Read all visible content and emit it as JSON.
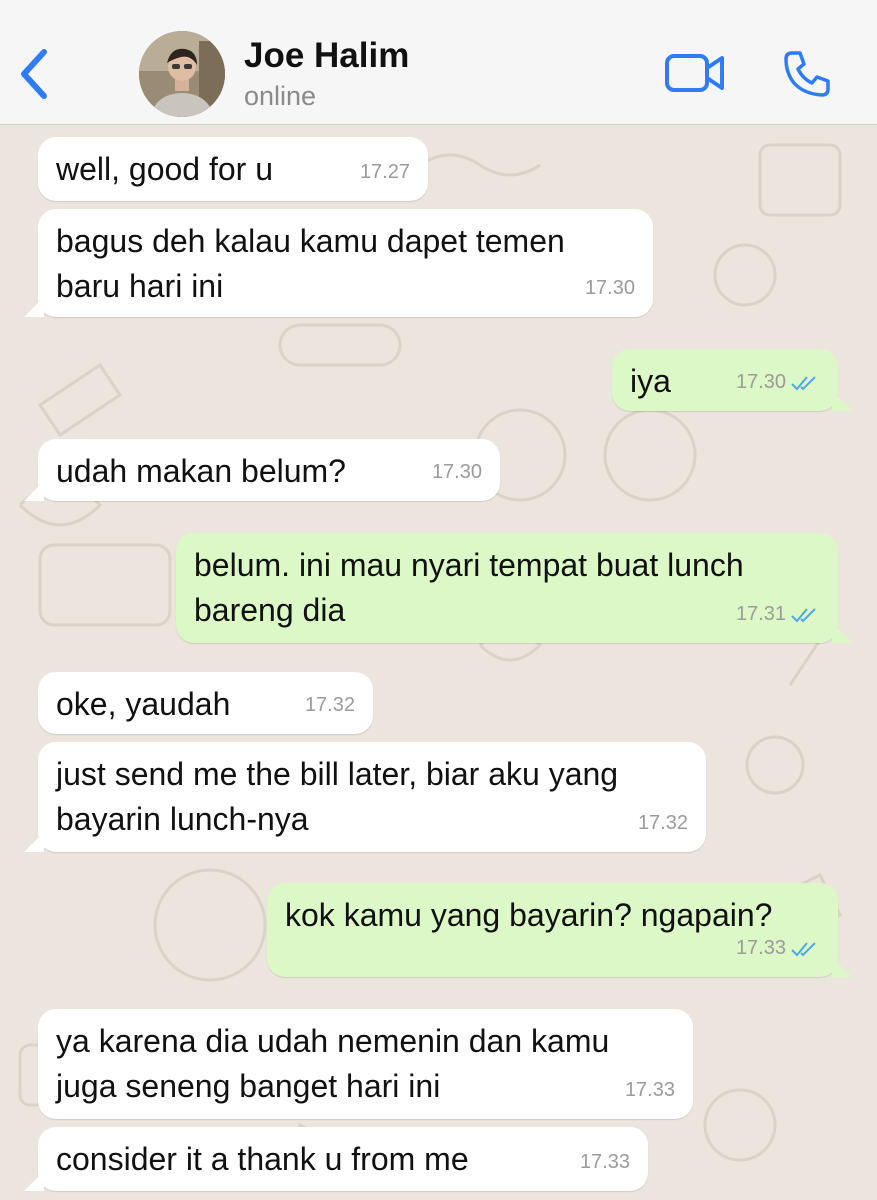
{
  "header": {
    "contact_name": "Joe Halim",
    "status": "online"
  },
  "colors": {
    "accent": "#2f7cf6",
    "incoming_bubble": "#ffffff",
    "outgoing_bubble": "#dcf8c6",
    "read_tick": "#4fa8e8"
  },
  "icons": {
    "back": "chevron-left-icon",
    "video": "video-camera-icon",
    "call": "phone-icon",
    "read": "double-check-icon"
  },
  "messages": [
    {
      "direction": "in",
      "text": "well, good for u",
      "time": "17.27"
    },
    {
      "direction": "in",
      "text": "bagus deh kalau kamu dapet temen\nbaru hari ini",
      "time": "17.30"
    },
    {
      "direction": "out",
      "text": "iya",
      "time": "17.30",
      "read": true
    },
    {
      "direction": "in",
      "text": "udah makan belum?",
      "time": "17.30"
    },
    {
      "direction": "out",
      "text": "belum. ini mau nyari tempat buat lunch\nbareng dia",
      "time": "17.31",
      "read": true
    },
    {
      "direction": "in",
      "text": "oke, yaudah",
      "time": "17.32"
    },
    {
      "direction": "in",
      "text": "just send me the bill later, biar aku yang\nbayarin lunch-nya",
      "time": "17.32"
    },
    {
      "direction": "out",
      "text": "kok kamu yang bayarin? ngapain?",
      "time": "17.33",
      "read": true
    },
    {
      "direction": "in",
      "text": "ya karena dia udah nemenin dan kamu\njuga seneng banget hari ini",
      "time": "17.33"
    },
    {
      "direction": "in",
      "text": "consider it a thank u from me",
      "time": "17.33"
    }
  ]
}
